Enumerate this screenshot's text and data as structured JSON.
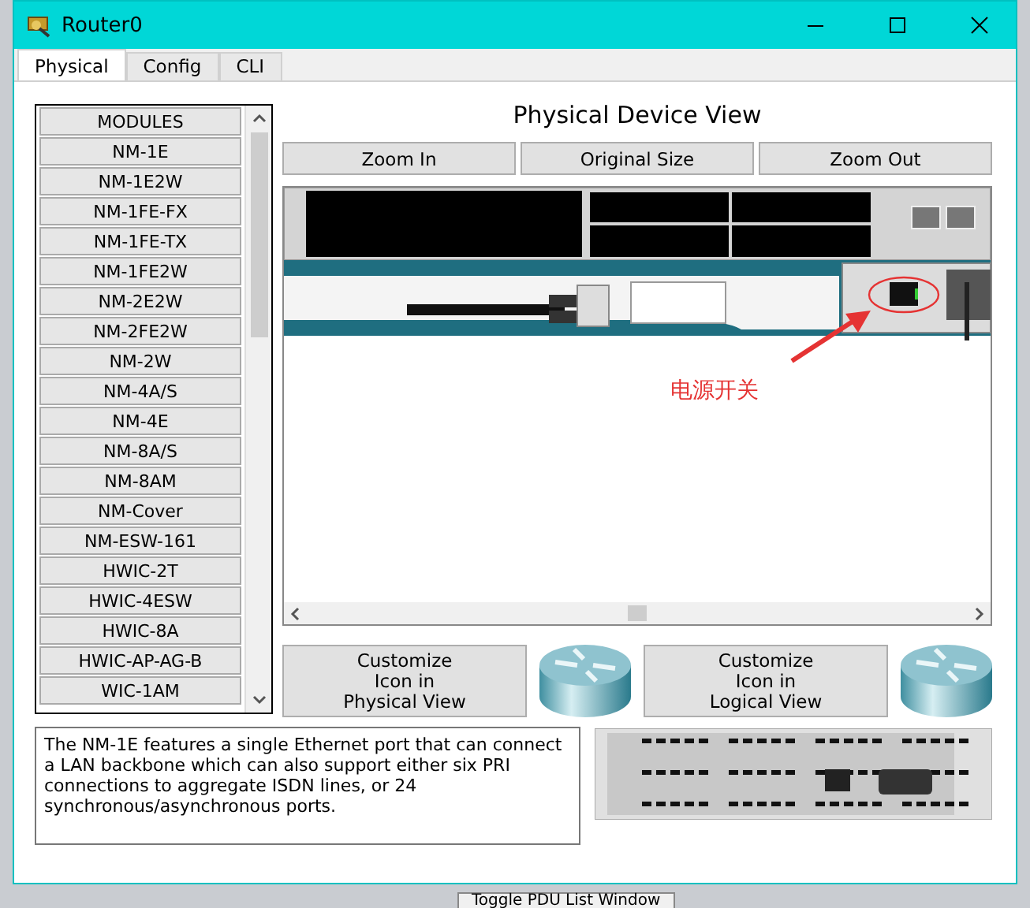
{
  "window": {
    "title": "Router0"
  },
  "tabs": [
    {
      "label": "Physical",
      "selected": true
    },
    {
      "label": "Config",
      "selected": false
    },
    {
      "label": "CLI",
      "selected": false
    }
  ],
  "modules": {
    "header": "MODULES",
    "items": [
      "NM-1E",
      "NM-1E2W",
      "NM-1FE-FX",
      "NM-1FE-TX",
      "NM-1FE2W",
      "NM-2E2W",
      "NM-2FE2W",
      "NM-2W",
      "NM-4A/S",
      "NM-4E",
      "NM-8A/S",
      "NM-8AM",
      "NM-Cover",
      "NM-ESW-161",
      "HWIC-2T",
      "HWIC-4ESW",
      "HWIC-8A",
      "HWIC-AP-AG-B",
      "WIC-1AM"
    ]
  },
  "view": {
    "title": "Physical Device View",
    "buttons": [
      "Zoom In",
      "Original Size",
      "Zoom Out"
    ],
    "annotation": "电源开关"
  },
  "customize": [
    "Customize\nIcon in\nPhysical View",
    "Customize\nIcon in\nLogical View"
  ],
  "description": "The NM-1E features a single Ethernet port that can connect a LAN backbone which can also support either six PRI connections to aggregate ISDN lines, or 24 synchronous/asynchronous ports.",
  "background": {
    "button": "Toggle PDU List Window"
  }
}
